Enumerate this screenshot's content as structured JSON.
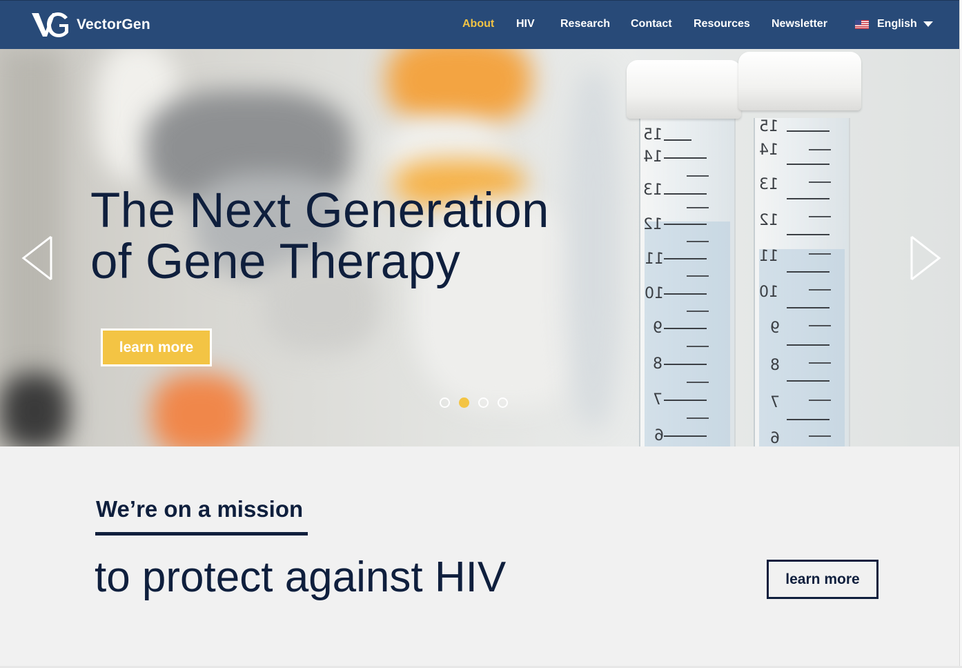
{
  "brand": {
    "name": "VectorGen",
    "mark": "VG"
  },
  "nav": {
    "items": [
      {
        "label": "About",
        "active": true
      },
      {
        "label": "HIV",
        "active": false
      },
      {
        "label": "Research",
        "active": false
      },
      {
        "label": "Contact",
        "active": false
      },
      {
        "label": "Resources",
        "active": false
      },
      {
        "label": "Newsletter",
        "active": false
      }
    ],
    "language": {
      "label": "English",
      "flag_icon": "us-flag-icon",
      "dropdown_icon": "caret-down-icon"
    }
  },
  "hero": {
    "title_line1": "The Next Generation",
    "title_line2": "of Gene Therapy",
    "button_label": "learn more",
    "prev_icon": "chevron-left-icon",
    "next_icon": "chevron-right-icon",
    "slides_total": 4,
    "active_slide": 2,
    "tube_graduations_left": [
      "15",
      "14",
      "13",
      "12",
      "11",
      "10",
      "9",
      "8",
      "7",
      "6"
    ],
    "tube_graduations_right": [
      "15",
      "14",
      "13",
      "12",
      "11",
      "10",
      "9",
      "8",
      "7",
      "6"
    ]
  },
  "mission": {
    "heading": "We’re on a mission",
    "subheading": "to protect against HIV",
    "button_label": "learn more"
  },
  "colors": {
    "nav_bg": "#284a78",
    "accent": "#f3c444",
    "text_dark": "#0f1f3d",
    "section_bg": "#f1f1f1"
  }
}
